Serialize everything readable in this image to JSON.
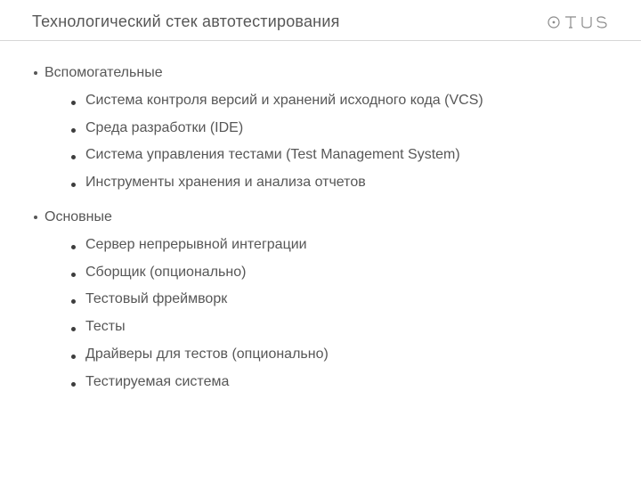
{
  "header": {
    "title": "Технологический стек автотестирования",
    "logo_text": "OTUS"
  },
  "sections": [
    {
      "label": "Вспомогательные",
      "items": [
        "Система контроля версий и хранений исходного кода (VCS)",
        "Среда разработки (IDE)",
        "Система управления тестами (Test Management System)",
        "Инструменты хранения и анализа отчетов"
      ]
    },
    {
      "label": "Основные",
      "items": [
        "Сервер непрерывной интеграции",
        "Сборщик (опционально)",
        "Тестовый фреймворк",
        "Тесты",
        "Драйверы для тестов (опционально)",
        "Тестируемая система"
      ]
    }
  ]
}
